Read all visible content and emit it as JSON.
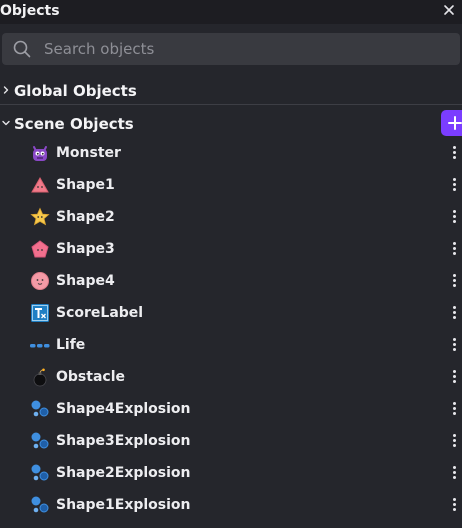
{
  "panel": {
    "title": "Objects",
    "close_icon": "close-icon"
  },
  "search": {
    "placeholder": "Search objects",
    "value": ""
  },
  "folders": {
    "global": {
      "label": "Global Objects",
      "expanded": false
    },
    "scene": {
      "label": "Scene Objects",
      "expanded": true
    }
  },
  "add_button": {
    "icon": "plus-icon",
    "color": "#7b3dff"
  },
  "objects": [
    {
      "name": "Monster",
      "icon": "monster-icon"
    },
    {
      "name": "Shape1",
      "icon": "triangle-shape-icon"
    },
    {
      "name": "Shape2",
      "icon": "star-shape-icon"
    },
    {
      "name": "Shape3",
      "icon": "pentagon-shape-icon"
    },
    {
      "name": "Shape4",
      "icon": "circle-shape-icon"
    },
    {
      "name": "ScoreLabel",
      "icon": "text-object-icon"
    },
    {
      "name": "Life",
      "icon": "life-hearts-icon"
    },
    {
      "name": "Obstacle",
      "icon": "bomb-icon"
    },
    {
      "name": "Shape4Explosion",
      "icon": "particle-emitter-icon"
    },
    {
      "name": "Shape3Explosion",
      "icon": "particle-emitter-icon"
    },
    {
      "name": "Shape2Explosion",
      "icon": "particle-emitter-icon"
    },
    {
      "name": "Shape1Explosion",
      "icon": "particle-emitter-icon"
    }
  ]
}
